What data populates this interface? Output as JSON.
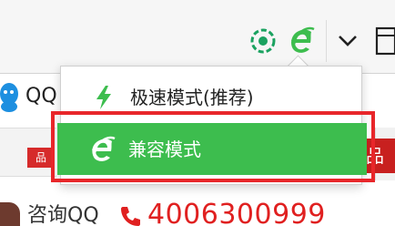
{
  "toolbar": {
    "icons": [
      "extension-icon",
      "ie-compat-mode-icon",
      "chevron-down-icon"
    ]
  },
  "menu": {
    "items": [
      {
        "label": "极速模式(推荐)",
        "icon": "lightning-bolt-icon",
        "selected": false
      },
      {
        "label": "兼容模式",
        "icon": "ie-logo-icon",
        "selected": true
      }
    ]
  },
  "page": {
    "qq_label": "QQ",
    "badge_left": "品",
    "badge_right": "品",
    "consult_label": "咨询QQ",
    "phone_number": "4006300999"
  },
  "colors": {
    "accent_green": "#3dbd4e",
    "annotation_red": "#e8262a",
    "phone_red": "#e02020"
  }
}
